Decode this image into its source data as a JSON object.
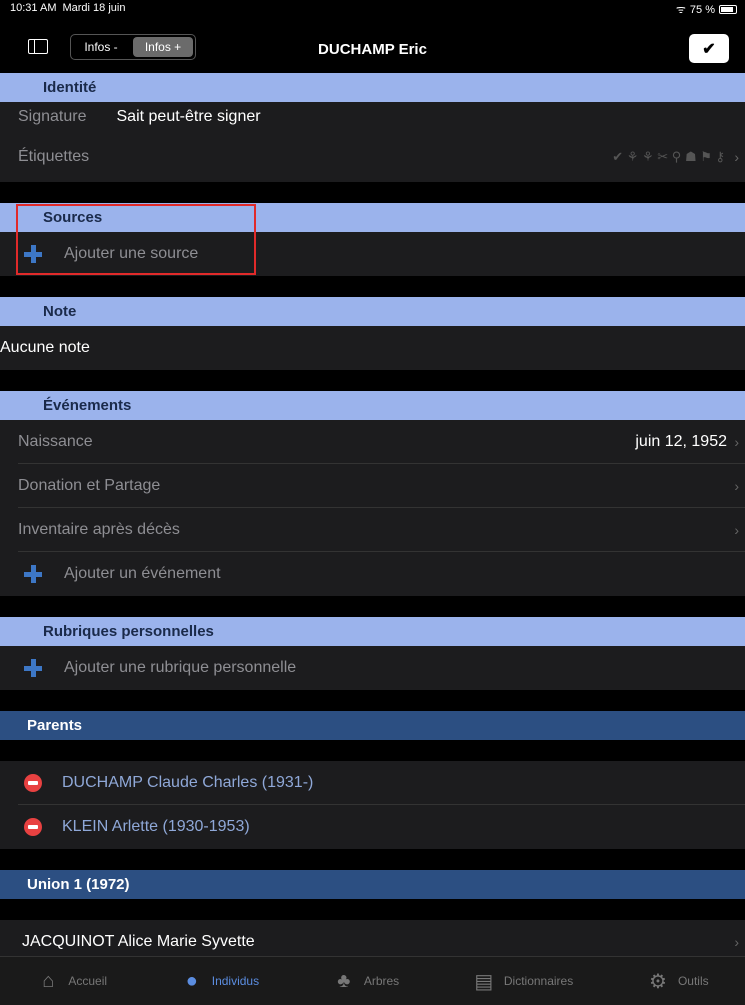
{
  "status": {
    "time": "10:31 AM",
    "date": "Mardi 18 juin",
    "battery": "75 %"
  },
  "nav": {
    "seg_minus": "Infos -",
    "seg_plus": "Infos +",
    "title": "DUCHAMP Eric",
    "done": "✔"
  },
  "identite": {
    "header": "Identité",
    "signature_label": "Signature",
    "signature_value": "Sait peut-être signer",
    "etiquettes_label": "Étiquettes",
    "tag_icons": "✔ ⚘ ⚘ ✂ ⚲ ☗ ⚑ ⚷"
  },
  "sources": {
    "header": "Sources",
    "add": "Ajouter une source"
  },
  "note": {
    "header": "Note",
    "text": "Aucune note"
  },
  "evenements": {
    "header": "Événements",
    "items": [
      {
        "label": "Naissance",
        "value": "juin 12, 1952"
      },
      {
        "label": "Donation et Partage",
        "value": ""
      },
      {
        "label": "Inventaire après décès",
        "value": ""
      }
    ],
    "add": "Ajouter un événement"
  },
  "rubriques": {
    "header": "Rubriques personnelles",
    "add": "Ajouter une rubrique personnelle"
  },
  "parents": {
    "header": "Parents",
    "items": [
      "DUCHAMP Claude Charles (1931-)",
      "KLEIN Arlette (1930-1953)"
    ]
  },
  "union": {
    "header": "Union 1 (1972)",
    "spouse": "JACQUINOT Alice Marie Syvette"
  },
  "tabs": [
    {
      "label": "Accueil",
      "icon": "home-icon"
    },
    {
      "label": "Individus",
      "icon": "person-icon"
    },
    {
      "label": "Arbres",
      "icon": "tree-icon"
    },
    {
      "label": "Dictionnaires",
      "icon": "book-icon"
    },
    {
      "label": "Outils",
      "icon": "gear-icon"
    }
  ],
  "colors": {
    "section": "#9bb3ec",
    "section_dark": "#2c4f82",
    "accent": "#3d77c6",
    "highlight": "#e02a2a"
  }
}
